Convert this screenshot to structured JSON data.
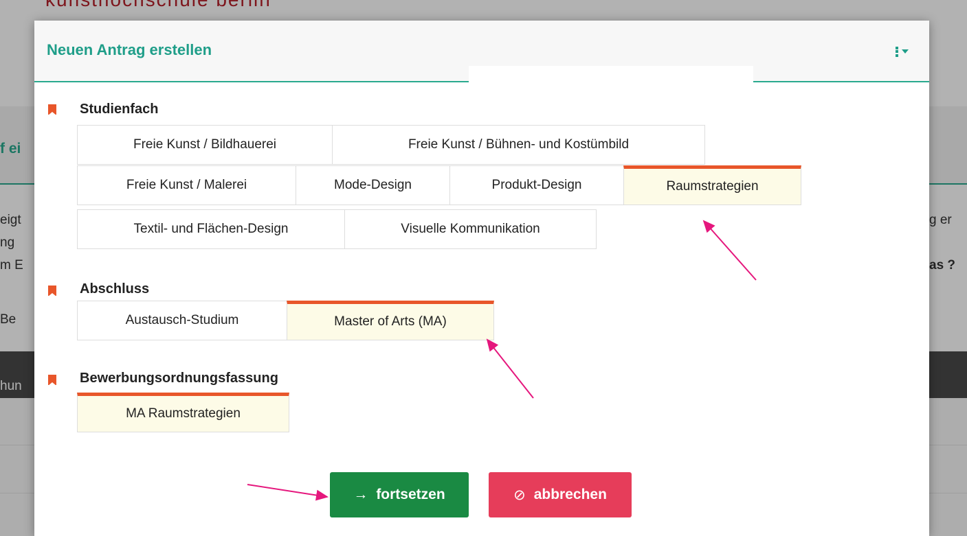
{
  "background": {
    "logo": "kunsthochschule berlin",
    "section_title": "f ei",
    "left_lines": [
      "eigt",
      "ng",
      "m E",
      "Be"
    ],
    "right_lines": [
      "g er",
      "as ?"
    ],
    "dark_bar_label": "hun"
  },
  "modal": {
    "title": "Neuen Antrag erstellen",
    "menu_icon": "more-vertical-icon"
  },
  "studienfach": {
    "label": "Studienfach",
    "options": [
      "Freie Kunst / Bildhauerei",
      "Freie Kunst / Bühnen- und Kostümbild",
      "Freie Kunst / Malerei",
      "Mode-Design",
      "Produkt-Design",
      "Raumstrategien",
      "Textil- und Flächen-Design",
      "Visuelle Kommunikation"
    ],
    "selected": "Raumstrategien"
  },
  "abschluss": {
    "label": "Abschluss",
    "options": [
      "Austausch-Studium",
      "Master of Arts (MA)"
    ],
    "selected": "Master of Arts (MA)"
  },
  "bewerbungsordnung": {
    "label": "Bewerbungsordnungsfassung",
    "options": [
      "MA Raumstrategien"
    ],
    "selected": "MA Raumstrategien"
  },
  "buttons": {
    "continue_label": "fortsetzen",
    "continue_icon": "→",
    "cancel_label": "abbrechen",
    "cancel_icon": "⊘"
  },
  "colors": {
    "accent": "#29a98e",
    "selection": "#e8562a",
    "continue": "#1a8a43",
    "cancel": "#e63d5a",
    "annotation": "#e5177d"
  }
}
